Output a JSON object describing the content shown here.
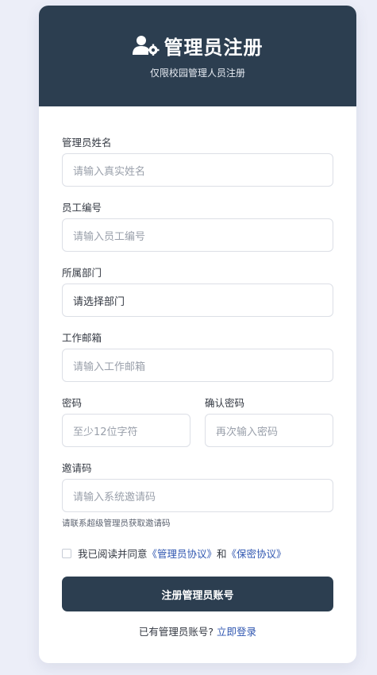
{
  "header": {
    "title": "管理员注册",
    "subtitle": "仅限校园管理人员注册",
    "icon": "user-gear-icon"
  },
  "form": {
    "name": {
      "label": "管理员姓名",
      "placeholder": "请输入真实姓名"
    },
    "employee_id": {
      "label": "员工编号",
      "placeholder": "请输入员工编号"
    },
    "department": {
      "label": "所属部门",
      "selected": "请选择部门"
    },
    "email": {
      "label": "工作邮箱",
      "placeholder": "请输入工作邮箱"
    },
    "password": {
      "label": "密码",
      "placeholder": "至少12位字符"
    },
    "confirm_password": {
      "label": "确认密码",
      "placeholder": "再次输入密码"
    },
    "invite_code": {
      "label": "邀请码",
      "placeholder": "请输入系统邀请码",
      "hint": "请联系超级管理员获取邀请码"
    }
  },
  "agreement": {
    "prefix": "我已阅读并同意",
    "link1": "《管理员协议》",
    "conjunction": "和",
    "link2": "《保密协议》"
  },
  "submit_label": "注册管理员账号",
  "login": {
    "prompt": "已有管理员账号?",
    "link": "立即登录"
  },
  "colors": {
    "header_bg": "#2c3e50",
    "button_bg": "#2c3e50",
    "link": "#2f56b0",
    "page_bg": "#eceef8"
  }
}
